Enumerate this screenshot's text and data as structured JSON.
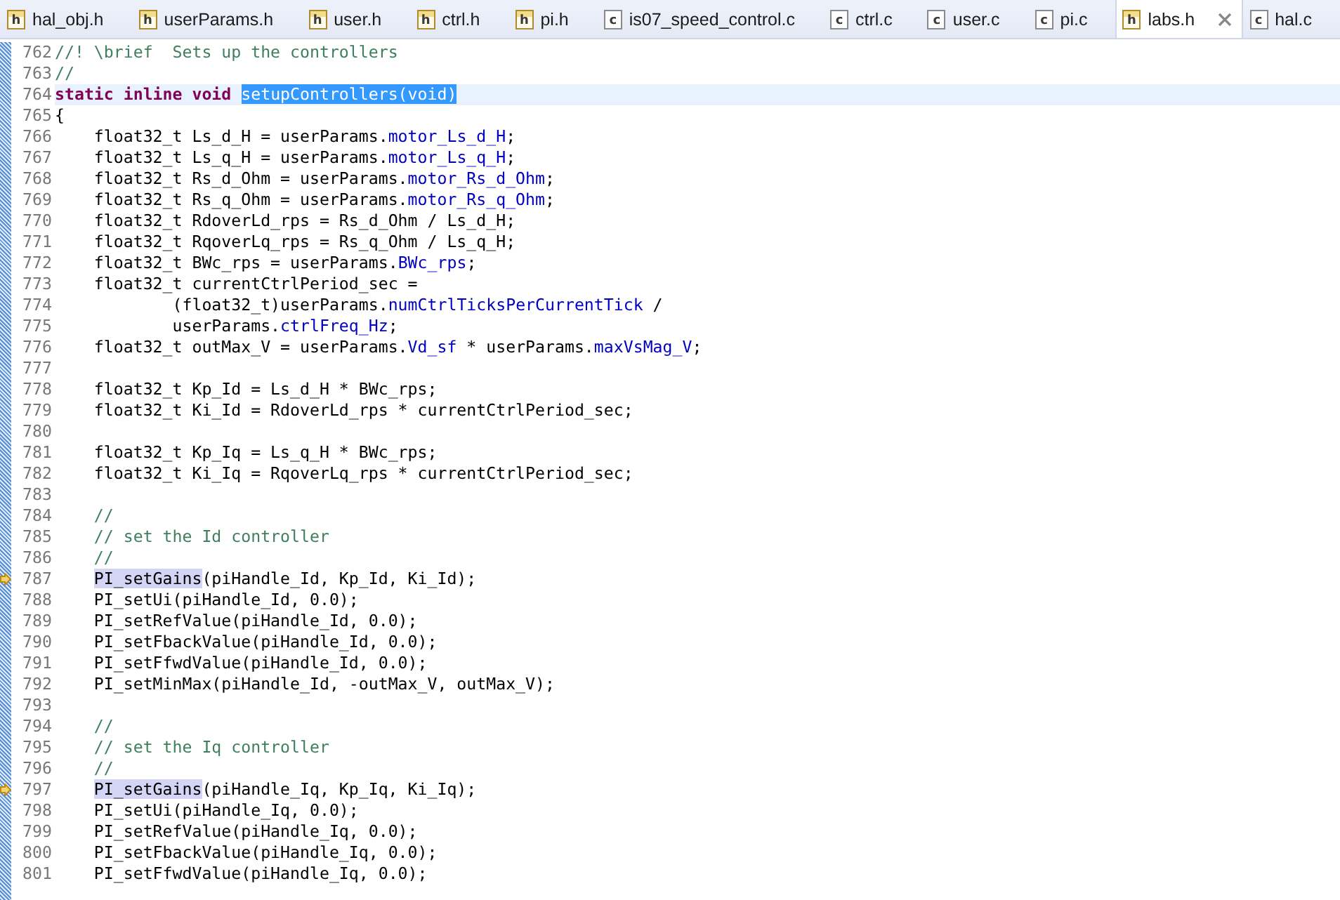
{
  "tabs": [
    {
      "label": "hal_obj.h",
      "kind": "header",
      "icon_letter": "h",
      "selected": false
    },
    {
      "label": "userParams.h",
      "kind": "header",
      "icon_letter": "h",
      "selected": false
    },
    {
      "label": "user.h",
      "kind": "header",
      "icon_letter": "h",
      "selected": false
    },
    {
      "label": "ctrl.h",
      "kind": "header",
      "icon_letter": "h",
      "selected": false
    },
    {
      "label": "pi.h",
      "kind": "header",
      "icon_letter": "h",
      "selected": false
    },
    {
      "label": "is07_speed_control.c",
      "kind": "source",
      "icon_letter": "c",
      "selected": false
    },
    {
      "label": "ctrl.c",
      "kind": "source",
      "icon_letter": "c",
      "selected": false
    },
    {
      "label": "user.c",
      "kind": "source",
      "icon_letter": "c",
      "selected": false
    },
    {
      "label": "pi.c",
      "kind": "source",
      "icon_letter": "c",
      "selected": false
    },
    {
      "label": "labs.h",
      "kind": "header",
      "icon_letter": "h",
      "selected": true
    },
    {
      "label": "hal.c",
      "kind": "source",
      "icon_letter": "c",
      "selected": false
    }
  ],
  "lines": [
    {
      "number": "762",
      "current": false,
      "marker": false,
      "segments": [
        {
          "text": "//! \\brief  Sets up the controllers",
          "kind": "comment"
        }
      ]
    },
    {
      "number": "763",
      "current": false,
      "marker": false,
      "segments": [
        {
          "text": "//",
          "kind": "comment"
        }
      ]
    },
    {
      "number": "764",
      "current": true,
      "marker": false,
      "segments": [
        {
          "text": "static inline void ",
          "kind": "keyword"
        },
        {
          "text": "setupControllers(void)",
          "kind": "selection"
        }
      ]
    },
    {
      "number": "765",
      "current": false,
      "marker": false,
      "segments": [
        {
          "text": "{",
          "kind": "plain"
        }
      ]
    },
    {
      "number": "766",
      "current": false,
      "marker": false,
      "segments": [
        {
          "text": "    float32_t Ls_d_H = userParams.",
          "kind": "plain"
        },
        {
          "text": "motor_Ls_d_H",
          "kind": "field"
        },
        {
          "text": ";",
          "kind": "plain"
        }
      ]
    },
    {
      "number": "767",
      "current": false,
      "marker": false,
      "segments": [
        {
          "text": "    float32_t Ls_q_H = userParams.",
          "kind": "plain"
        },
        {
          "text": "motor_Ls_q_H",
          "kind": "field"
        },
        {
          "text": ";",
          "kind": "plain"
        }
      ]
    },
    {
      "number": "768",
      "current": false,
      "marker": false,
      "segments": [
        {
          "text": "    float32_t Rs_d_Ohm = userParams.",
          "kind": "plain"
        },
        {
          "text": "motor_Rs_d_Ohm",
          "kind": "field"
        },
        {
          "text": ";",
          "kind": "plain"
        }
      ]
    },
    {
      "number": "769",
      "current": false,
      "marker": false,
      "segments": [
        {
          "text": "    float32_t Rs_q_Ohm = userParams.",
          "kind": "plain"
        },
        {
          "text": "motor_Rs_q_Ohm",
          "kind": "field"
        },
        {
          "text": ";",
          "kind": "plain"
        }
      ]
    },
    {
      "number": "770",
      "current": false,
      "marker": false,
      "segments": [
        {
          "text": "    float32_t RdoverLd_rps = Rs_d_Ohm / Ls_d_H;",
          "kind": "plain"
        }
      ]
    },
    {
      "number": "771",
      "current": false,
      "marker": false,
      "segments": [
        {
          "text": "    float32_t RqoverLq_rps = Rs_q_Ohm / Ls_q_H;",
          "kind": "plain"
        }
      ]
    },
    {
      "number": "772",
      "current": false,
      "marker": false,
      "segments": [
        {
          "text": "    float32_t BWc_rps = userParams.",
          "kind": "plain"
        },
        {
          "text": "BWc_rps",
          "kind": "field"
        },
        {
          "text": ";",
          "kind": "plain"
        }
      ]
    },
    {
      "number": "773",
      "current": false,
      "marker": false,
      "segments": [
        {
          "text": "    float32_t currentCtrlPeriod_sec =",
          "kind": "plain"
        }
      ]
    },
    {
      "number": "774",
      "current": false,
      "marker": false,
      "segments": [
        {
          "text": "            (float32_t)userParams.",
          "kind": "plain"
        },
        {
          "text": "numCtrlTicksPerCurrentTick",
          "kind": "field"
        },
        {
          "text": " /",
          "kind": "plain"
        }
      ]
    },
    {
      "number": "775",
      "current": false,
      "marker": false,
      "segments": [
        {
          "text": "            userParams.",
          "kind": "plain"
        },
        {
          "text": "ctrlFreq_Hz",
          "kind": "field"
        },
        {
          "text": ";",
          "kind": "plain"
        }
      ]
    },
    {
      "number": "776",
      "current": false,
      "marker": false,
      "segments": [
        {
          "text": "    float32_t outMax_V = userParams.",
          "kind": "plain"
        },
        {
          "text": "Vd_sf",
          "kind": "field"
        },
        {
          "text": " * userParams.",
          "kind": "plain"
        },
        {
          "text": "maxVsMag_V",
          "kind": "field"
        },
        {
          "text": ";",
          "kind": "plain"
        }
      ]
    },
    {
      "number": "777",
      "current": false,
      "marker": false
    },
    {
      "number": "778",
      "current": false,
      "marker": false,
      "segments": [
        {
          "text": "    float32_t Kp_Id = Ls_d_H * BWc_rps;",
          "kind": "plain"
        }
      ]
    },
    {
      "number": "779",
      "current": false,
      "marker": false,
      "segments": [
        {
          "text": "    float32_t Ki_Id = RdoverLd_rps * currentCtrlPeriod_sec;",
          "kind": "plain"
        }
      ]
    },
    {
      "number": "780",
      "current": false,
      "marker": false
    },
    {
      "number": "781",
      "current": false,
      "marker": false,
      "segments": [
        {
          "text": "    float32_t Kp_Iq = Ls_q_H * BWc_rps;",
          "kind": "plain"
        }
      ]
    },
    {
      "number": "782",
      "current": false,
      "marker": false,
      "segments": [
        {
          "text": "    float32_t Ki_Iq = RqoverLq_rps * currentCtrlPeriod_sec;",
          "kind": "plain"
        }
      ]
    },
    {
      "number": "783",
      "current": false,
      "marker": false
    },
    {
      "number": "784",
      "current": false,
      "marker": false,
      "segments": [
        {
          "text": "    //",
          "kind": "comment"
        }
      ]
    },
    {
      "number": "785",
      "current": false,
      "marker": false,
      "segments": [
        {
          "text": "    // set the Id controller",
          "kind": "comment"
        }
      ]
    },
    {
      "number": "786",
      "current": false,
      "marker": false,
      "segments": [
        {
          "text": "    //",
          "kind": "comment"
        }
      ]
    },
    {
      "number": "787",
      "current": false,
      "marker": true,
      "indented": true,
      "segments": [
        {
          "text": "PI_setGains",
          "kind": "occurrence"
        },
        {
          "text": "(piHandle_Id, Kp_Id, Ki_Id);",
          "kind": "plain"
        }
      ]
    },
    {
      "number": "788",
      "current": false,
      "marker": false,
      "segments": [
        {
          "text": "    PI_setUi(piHandle_Id, 0.0);",
          "kind": "plain"
        }
      ]
    },
    {
      "number": "789",
      "current": false,
      "marker": false,
      "segments": [
        {
          "text": "    PI_setRefValue(piHandle_Id, 0.0);",
          "kind": "plain"
        }
      ]
    },
    {
      "number": "790",
      "current": false,
      "marker": false,
      "segments": [
        {
          "text": "    PI_setFbackValue(piHandle_Id, 0.0);",
          "kind": "plain"
        }
      ]
    },
    {
      "number": "791",
      "current": false,
      "marker": false,
      "segments": [
        {
          "text": "    PI_setFfwdValue(piHandle_Id, 0.0);",
          "kind": "plain"
        }
      ]
    },
    {
      "number": "792",
      "current": false,
      "marker": false,
      "segments": [
        {
          "text": "    PI_setMinMax(piHandle_Id, -outMax_V, outMax_V);",
          "kind": "plain"
        }
      ]
    },
    {
      "number": "793",
      "current": false,
      "marker": false
    },
    {
      "number": "794",
      "current": false,
      "marker": false,
      "segments": [
        {
          "text": "    //",
          "kind": "comment"
        }
      ]
    },
    {
      "number": "795",
      "current": false,
      "marker": false,
      "segments": [
        {
          "text": "    // set the Iq controller",
          "kind": "comment"
        }
      ]
    },
    {
      "number": "796",
      "current": false,
      "marker": false,
      "segments": [
        {
          "text": "    //",
          "kind": "comment"
        }
      ]
    },
    {
      "number": "797",
      "current": false,
      "marker": true,
      "indented": true,
      "segments": [
        {
          "text": "PI_setGains",
          "kind": "occurrence"
        },
        {
          "text": "(piHandle_Iq, Kp_Iq, Ki_Iq);",
          "kind": "plain"
        }
      ]
    },
    {
      "number": "798",
      "current": false,
      "marker": false,
      "segments": [
        {
          "text": "    PI_setUi(piHandle_Iq, 0.0);",
          "kind": "plain"
        }
      ]
    },
    {
      "number": "799",
      "current": false,
      "marker": false,
      "segments": [
        {
          "text": "    PI_setRefValue(piHandle_Iq, 0.0);",
          "kind": "plain"
        }
      ]
    },
    {
      "number": "800",
      "current": false,
      "marker": false,
      "segments": [
        {
          "text": "    PI_setFbackValue(piHandle_Iq, 0.0);",
          "kind": "plain"
        }
      ]
    },
    {
      "number": "801",
      "current": false,
      "marker": false,
      "segments": [
        {
          "text": "    PI_setFfwdValue(piHandle_Iq, 0.0);",
          "kind": "plain"
        }
      ]
    }
  ]
}
